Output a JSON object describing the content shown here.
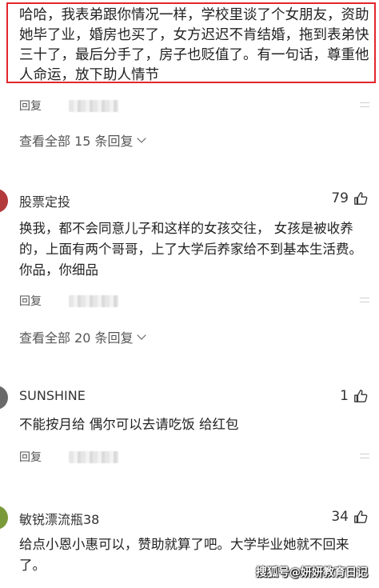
{
  "highlighted_comment": {
    "text": "哈哈，我表弟跟你情况一样，学校里谈了个女朋友，资助她毕了业，婚房也买了，女方迟迟不肯结婚，拖到表弟快三十了，最后分手了，房子也贬值了。有一句话，尊重他人命运，放下助人情节"
  },
  "reply_label": "回复",
  "threads": [
    {
      "view_all": "查看全部 15 条回复"
    },
    {
      "view_all": "查看全部 20 条回复"
    }
  ],
  "comments": [
    {
      "username": "股票定投",
      "likes": "79",
      "text": "换我，都不会同意儿子和这样的女孩交往， 女孩是被收养的，上面有两个哥哥，上了大学后养家给不到基本生活费。 你品，你细品",
      "avatar_color": "#b33a3a"
    },
    {
      "username": "SUNSHINE",
      "likes": "1",
      "text": "不能按月给 偶尔可以去请吃饭 给红包",
      "avatar_color": "#6a6a6a"
    },
    {
      "username": "敏锐漂流瓶38",
      "likes": "34",
      "text": "给点小恩小惠可以，赞助就算了吧。大学毕业她就不回来了。",
      "avatar_color": "#7a9a3a"
    }
  ],
  "watermark": "搜狐号@妍妍教育日记"
}
